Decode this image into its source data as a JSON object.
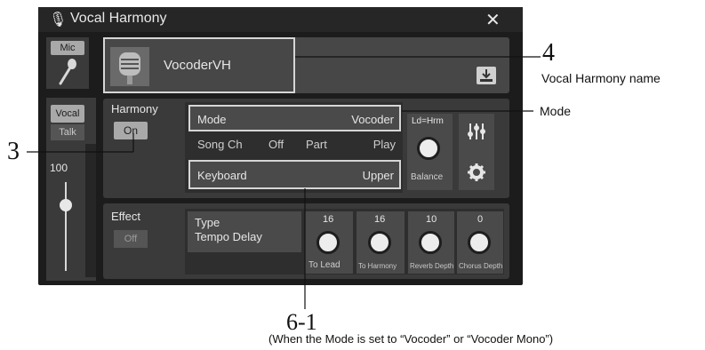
{
  "window": {
    "title": "Vocal Harmony",
    "close_label": "✕"
  },
  "sidebar": {
    "mic_tab": "Mic",
    "vocal_tab": "Vocal",
    "talk_tab": "Talk",
    "volume_value": "100"
  },
  "preset": {
    "name": "VocoderVH"
  },
  "harmony": {
    "label": "Harmony",
    "on_button": "On",
    "mode_label": "Mode",
    "mode_value": "Vocoder",
    "song_ch_label": "Song Ch",
    "song_ch_value": "Off",
    "part_label": "Part",
    "part_value": "Play",
    "keyboard_label": "Keyboard",
    "keyboard_value": "Upper",
    "balance_top": "Ld=Hrm",
    "balance_label": "Balance"
  },
  "effect": {
    "label": "Effect",
    "off_button": "Off",
    "type_label": "Type",
    "type_value": "Tempo Delay",
    "knobs": [
      {
        "value": "16",
        "label": "To Lead"
      },
      {
        "value": "16",
        "label": "To Harmony"
      },
      {
        "value": "10",
        "label": "Reverb Depth"
      },
      {
        "value": "0",
        "label": "Chorus Depth"
      }
    ]
  },
  "annotations": {
    "num4": "4",
    "text4": "Vocal Harmony name",
    "mode": "Mode",
    "num3": "3",
    "num61": "6-1",
    "text61": "(When the Mode is set to “Vocoder” or “Vocoder Mono”)"
  }
}
